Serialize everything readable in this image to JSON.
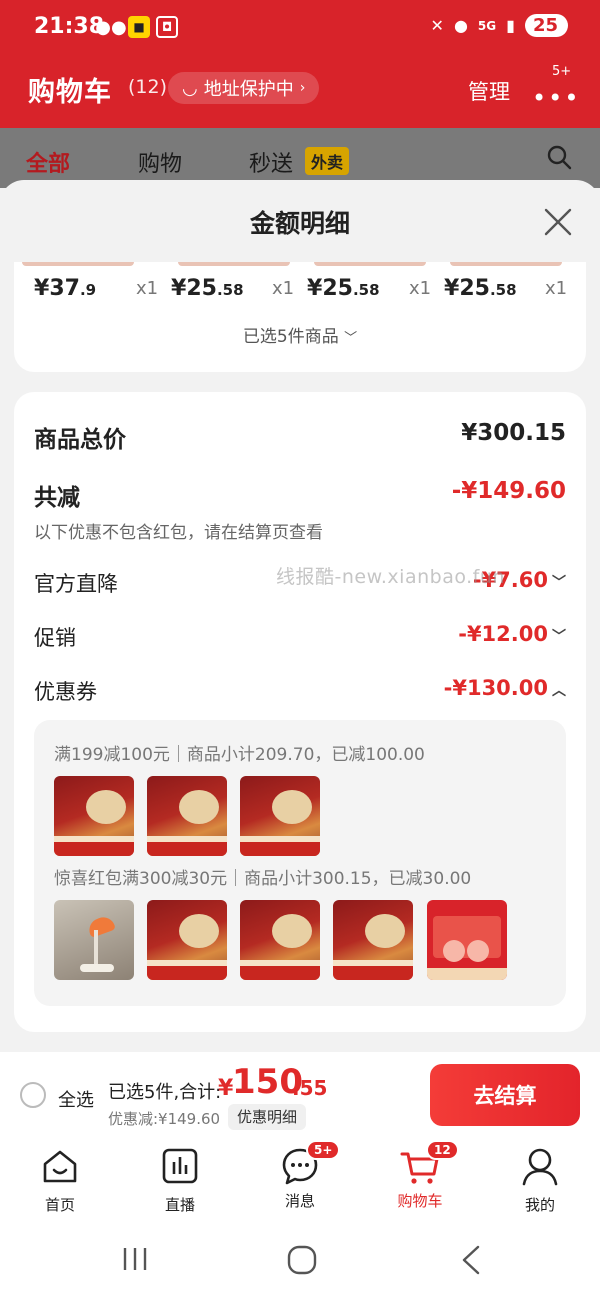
{
  "status_bar": {
    "time": "21:38",
    "signal_text": "5G",
    "battery": "25"
  },
  "header": {
    "title": "购物车",
    "count": "(12)",
    "address": "地址保护中",
    "manage": "管理",
    "more_badge": "5+"
  },
  "tabs": [
    {
      "label": "全部"
    },
    {
      "label": "购物"
    },
    {
      "label": "秒送"
    }
  ],
  "takeaway_badge": "外卖",
  "sheet": {
    "title": "金额明细",
    "products": [
      {
        "yen": "¥",
        "int": "37",
        "dec": ".9",
        "qty": "x1"
      },
      {
        "yen": "¥",
        "int": "25",
        "dec": ".58",
        "qty": "x1"
      },
      {
        "yen": "¥",
        "int": "25",
        "dec": ".58",
        "qty": "x1"
      },
      {
        "yen": "¥",
        "int": "25",
        "dec": ".58",
        "qty": "x1"
      }
    ],
    "selected_summary": "已选5件商品"
  },
  "detail": {
    "subtotal_label": "商品总价",
    "subtotal_value": "¥300.15",
    "reduction_label": "共减",
    "reduction_value": "-¥149.60",
    "reduction_note": "以下优惠不包含红包，请在结算页查看",
    "official_label": "官方直降",
    "official_value": "-¥7.60",
    "promo_label": "促销",
    "promo_value": "-¥12.00",
    "coupon_label": "优惠券",
    "coupon_value": "-¥130.00",
    "coupon_groups": [
      {
        "text": "满199减100元｜商品小计209.70，已减100.00"
      },
      {
        "text": "惊喜红包满300减30元｜商品小计300.15，已减30.00"
      }
    ]
  },
  "watermark": "线报酷-new.xianbao.fun",
  "checkout": {
    "select_all": "全选",
    "total_label": "已选5件,合计:",
    "total_yen": "¥",
    "total_int": "150",
    "total_dec": ".55",
    "saving": "优惠减:¥149.60",
    "detail_button": "优惠明细",
    "checkout_button": "去结算"
  },
  "bottom_nav": [
    {
      "label": "首页",
      "icon": "home-icon"
    },
    {
      "label": "直播",
      "icon": "live-icon"
    },
    {
      "label": "消息",
      "icon": "message-icon",
      "badge": "5+"
    },
    {
      "label": "购物车",
      "icon": "cart-icon",
      "badge": "12",
      "active": true
    },
    {
      "label": "我的",
      "icon": "profile-icon"
    }
  ],
  "colors": {
    "brand_red": "#d8232a",
    "price_red": "#e02a2a",
    "takeaway_yellow": "#d7a400"
  }
}
